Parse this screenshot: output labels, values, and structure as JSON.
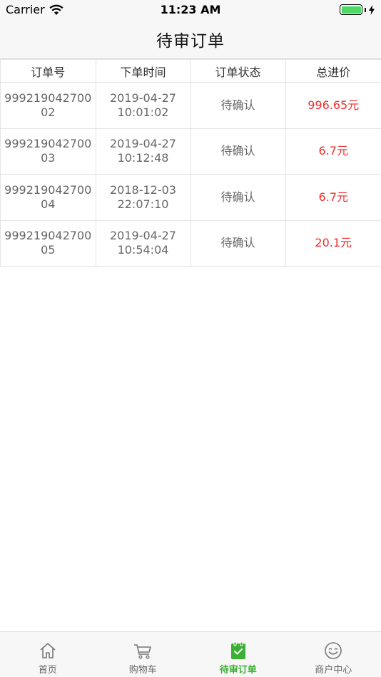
{
  "status_bar": {
    "carrier": "Carrier",
    "time": "11:23 AM"
  },
  "nav": {
    "title": "待审订单"
  },
  "table": {
    "headers": [
      "订单号",
      "下单时间",
      "订单状态",
      "总进价"
    ],
    "rows": [
      {
        "order_no": "99921904270002",
        "date": "2019-04-27",
        "time": "10:01:02",
        "status": "待确认",
        "price": "996.65元"
      },
      {
        "order_no": "99921904270003",
        "date": "2019-04-27",
        "time": "10:12:48",
        "status": "待确认",
        "price": "6.7元"
      },
      {
        "order_no": "99921904270004",
        "date": "2018-12-03",
        "time": "22:07:10",
        "status": "待确认",
        "price": "6.7元"
      },
      {
        "order_no": "99921904270005",
        "date": "2019-04-27",
        "time": "10:54:04",
        "status": "待确认",
        "price": "20.1元"
      }
    ]
  },
  "tabs": [
    {
      "label": "首页",
      "icon": "home-icon"
    },
    {
      "label": "购物车",
      "icon": "cart-icon"
    },
    {
      "label": "待审订单",
      "icon": "clipboard-check-icon",
      "active": true
    },
    {
      "label": "商户中心",
      "icon": "smiley-icon"
    }
  ],
  "colors": {
    "accent": "#3cb034",
    "price": "#f02b2b",
    "battery": "#4cd964"
  }
}
